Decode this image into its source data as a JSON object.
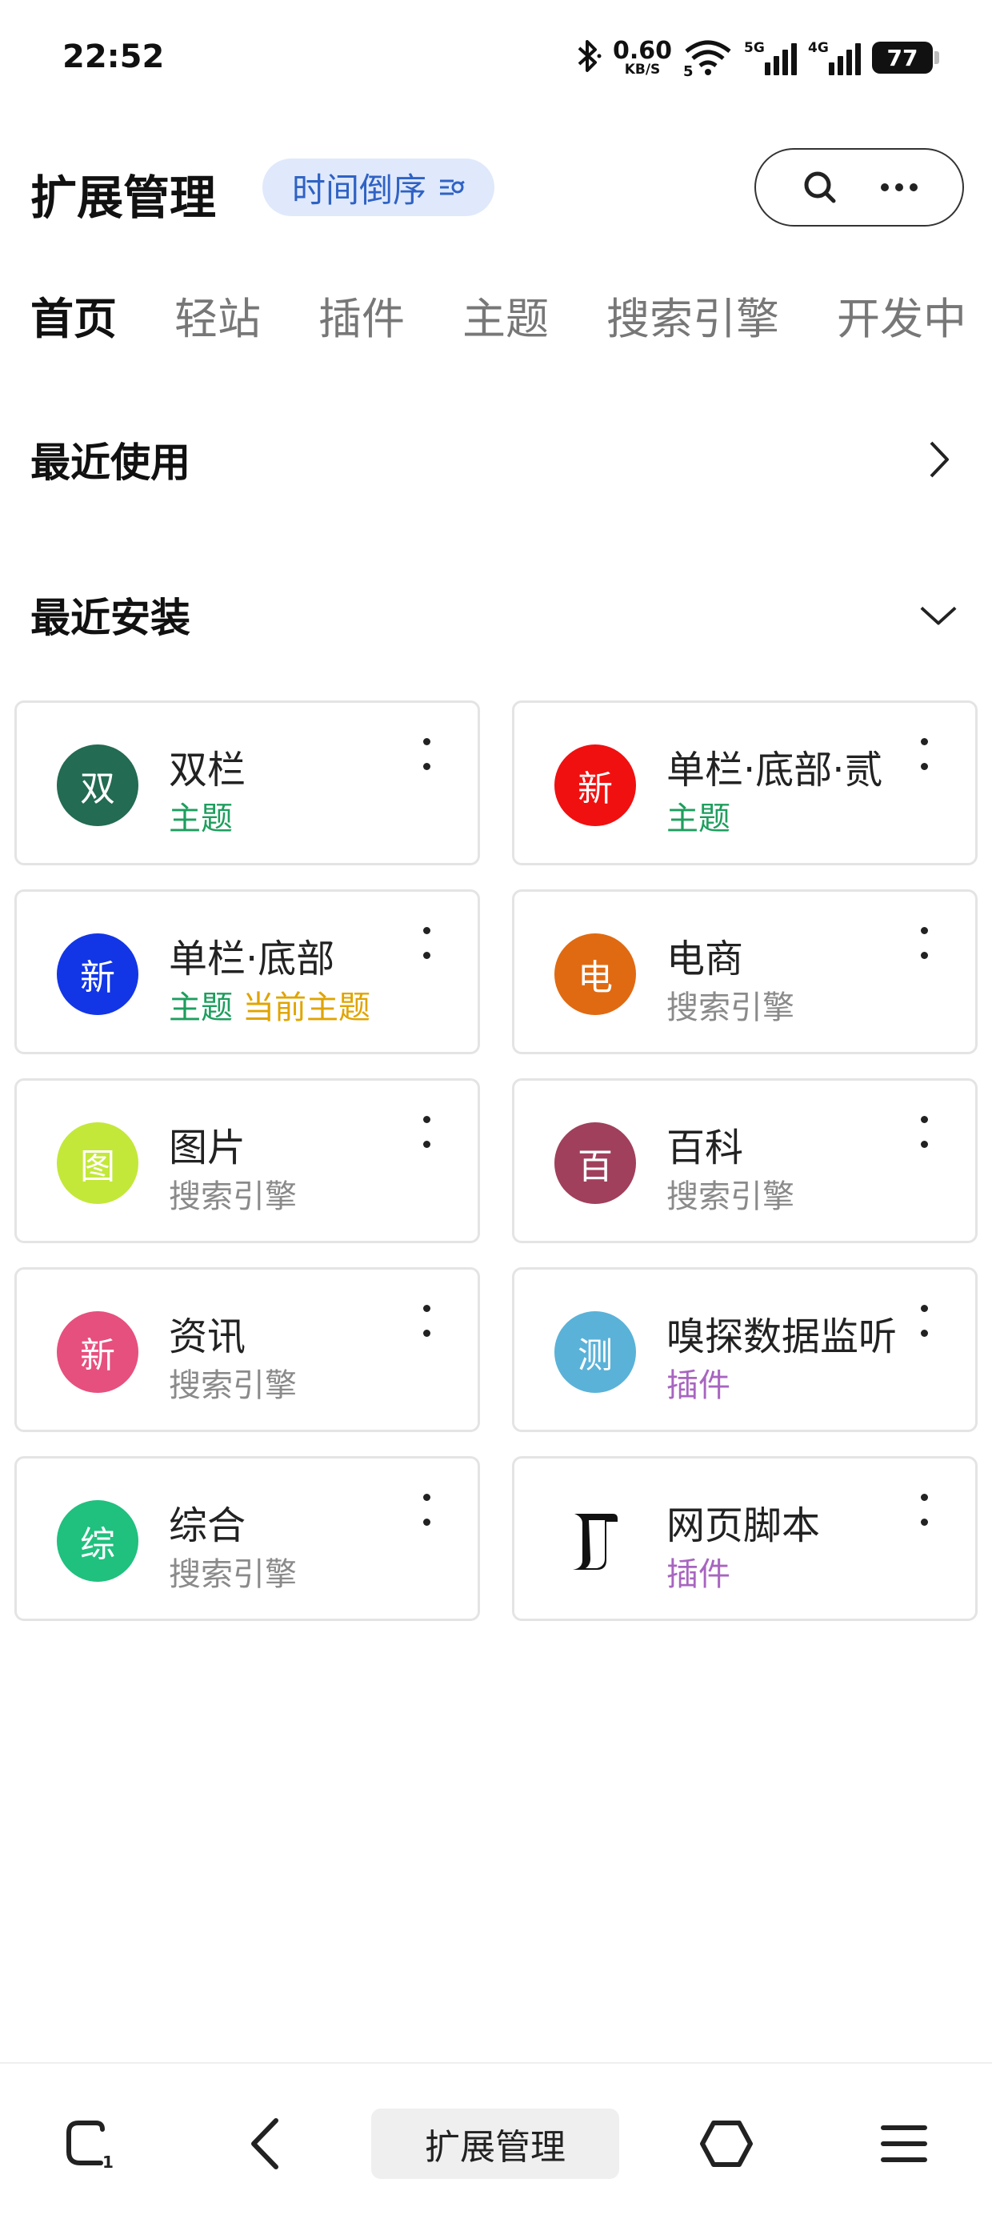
{
  "status_bar": {
    "time": "22:52",
    "net_speed_value": "0.60",
    "net_speed_unit": "KB/S",
    "wifi_sub": "5",
    "sig1_label": "5G",
    "sig2_label": "4G",
    "battery": "77"
  },
  "header": {
    "title": "扩展管理",
    "sort_label": "时间倒序"
  },
  "tabs": [
    {
      "label": "首页",
      "active": true
    },
    {
      "label": "轻站"
    },
    {
      "label": "插件"
    },
    {
      "label": "主题"
    },
    {
      "label": "搜索引擎"
    },
    {
      "label": "开发中"
    }
  ],
  "sections": {
    "recent_used": "最近使用",
    "recent_installed": "最近安装"
  },
  "cards": [
    {
      "initial": "双",
      "name": "双栏",
      "type": "主题",
      "color": "#236b52",
      "type_color": "#1e9e5e"
    },
    {
      "initial": "新",
      "name": "单栏·底部·贰",
      "type": "主题",
      "color": "#f01010",
      "type_color": "#1e9e5e"
    },
    {
      "initial": "新",
      "name": "单栏·底部",
      "type": "主题",
      "extra": "当前主题",
      "color": "#1236e6",
      "type_color": "#1e9e5e"
    },
    {
      "initial": "电",
      "name": "电商",
      "type": "搜索引擎",
      "color": "#e06a12",
      "type_color": "#8a8a8a"
    },
    {
      "initial": "图",
      "name": "图片",
      "type": "搜索引擎",
      "color": "#c3e83a",
      "type_color": "#8a8a8a"
    },
    {
      "initial": "百",
      "name": "百科",
      "type": "搜索引擎",
      "color": "#a0405c",
      "type_color": "#8a8a8a"
    },
    {
      "initial": "新",
      "name": "资讯",
      "type": "搜索引擎",
      "color": "#e6507e",
      "type_color": "#8a8a8a"
    },
    {
      "initial": "测",
      "name": "嗅探数据监听",
      "type": "插件",
      "color": "#5ab2d8",
      "type_color": "#a865c0"
    },
    {
      "initial": "综",
      "name": "综合",
      "type": "搜索引擎",
      "color": "#20c07e",
      "type_color": "#8a8a8a"
    },
    {
      "initial": "",
      "name": "网页脚本",
      "type": "插件",
      "color": "#ffffff",
      "type_color": "#a865c0",
      "logo": true
    }
  ],
  "bottom_nav": {
    "tabs_count": "1",
    "center_label": "扩展管理"
  }
}
